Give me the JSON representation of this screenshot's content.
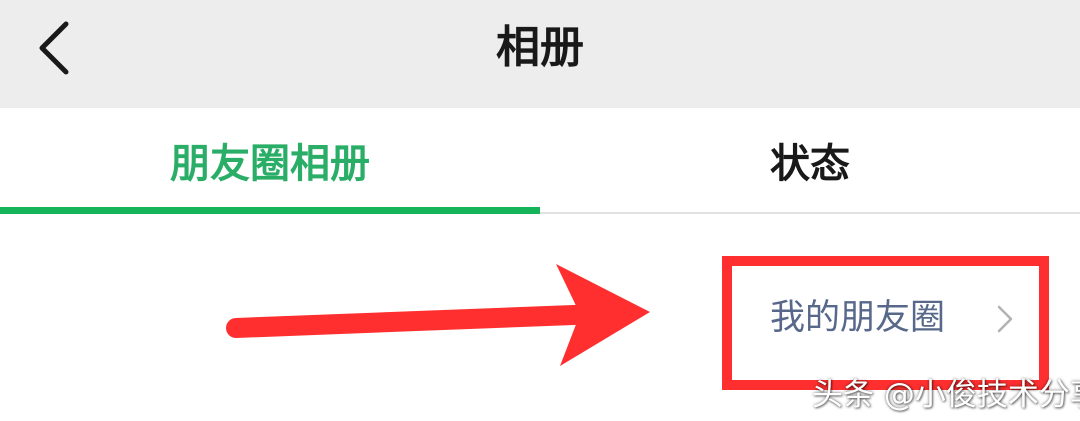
{
  "navbar": {
    "title": "相册",
    "back_icon": "chevron-left-icon",
    "background": "#ededed"
  },
  "tabs": [
    {
      "label": "朋友圈相册",
      "active": true
    },
    {
      "label": "状态",
      "active": false
    }
  ],
  "colors": {
    "accent_green": "#15b35a",
    "active_tab_text": "#2aae67",
    "link_text": "#57688a",
    "annotation_red": "#ff2f2f"
  },
  "content": {
    "my_moments_label": "我的朋友圈",
    "my_moments_icon": "chevron-right-icon"
  },
  "watermark": "头条 @小俊技术分享"
}
